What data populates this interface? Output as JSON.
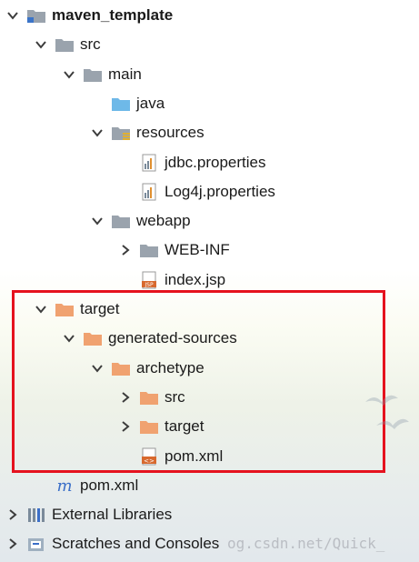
{
  "tree": {
    "rows": [
      {
        "label": "maven_template",
        "bold": true,
        "arrow": "down",
        "icon": "module-folder-icon",
        "depth": 0
      },
      {
        "label": "src",
        "arrow": "down",
        "icon": "folder-icon",
        "depth": 1
      },
      {
        "label": "main",
        "arrow": "down",
        "icon": "folder-icon",
        "depth": 2
      },
      {
        "label": "java",
        "arrow": "none",
        "icon": "source-folder-icon",
        "depth": 3
      },
      {
        "label": "resources",
        "arrow": "down",
        "icon": "resources-folder-icon",
        "depth": 3
      },
      {
        "label": "jdbc.properties",
        "arrow": "none",
        "icon": "properties-file-icon",
        "depth": 4
      },
      {
        "label": "Log4j.properties",
        "arrow": "none",
        "icon": "properties-file-icon",
        "depth": 4
      },
      {
        "label": "webapp",
        "arrow": "down",
        "icon": "folder-icon",
        "depth": 3
      },
      {
        "label": "WEB-INF",
        "arrow": "right",
        "icon": "folder-icon",
        "depth": 4
      },
      {
        "label": "index.jsp",
        "arrow": "none",
        "icon": "jsp-file-icon",
        "depth": 4
      },
      {
        "label": "target",
        "arrow": "down",
        "icon": "excluded-folder-icon",
        "depth": 1
      },
      {
        "label": "generated-sources",
        "arrow": "down",
        "icon": "excluded-folder-icon",
        "depth": 2
      },
      {
        "label": "archetype",
        "arrow": "down",
        "icon": "excluded-folder-icon",
        "depth": 3
      },
      {
        "label": "src",
        "arrow": "right",
        "icon": "excluded-folder-icon",
        "depth": 4
      },
      {
        "label": "target",
        "arrow": "right",
        "icon": "excluded-folder-icon",
        "depth": 4
      },
      {
        "label": "pom.xml",
        "arrow": "none",
        "icon": "xml-file-icon",
        "depth": 4
      },
      {
        "label": "pom.xml",
        "arrow": "none",
        "icon": "maven-file-icon",
        "depth": 1
      },
      {
        "label": "External Libraries",
        "arrow": "right",
        "icon": "libraries-icon",
        "depth": 0
      },
      {
        "label": "Scratches and Consoles",
        "arrow": "right",
        "icon": "scratches-icon",
        "depth": 0
      }
    ]
  },
  "watermark": "og.csdn.net/Quick_",
  "colors": {
    "highlight_border": "#e5121e",
    "folder": "#9aa3ad",
    "excluded_folder": "#f0a270",
    "source_folder": "#6fb8e8",
    "arrow": "#3c3c3c"
  }
}
